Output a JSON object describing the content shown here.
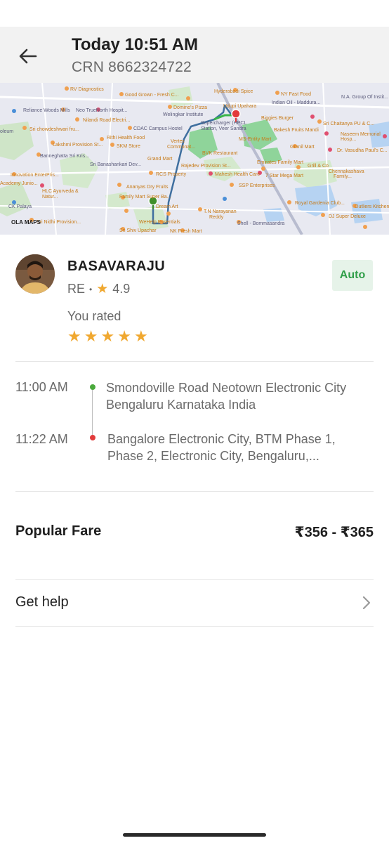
{
  "header": {
    "title": "Today 10:51 AM",
    "crn": "CRN 8662324722",
    "back_icon": "arrow-left-icon"
  },
  "map": {
    "watermark": "OLA MAPS",
    "labels": [
      "RV Diagnostics",
      "Good Grown - Fresh C...",
      "Hyderabadi Spice",
      "NY Fast Food",
      "N.A. Group Of Instit...",
      "Domino's Pizza",
      "Indian Oil - Maddura...",
      "Reliance Woods Mills",
      "Neo TrueNorth Hospit...",
      "Welingkar Institute",
      "Udupi Upahara",
      "Biggies Burger",
      "Sri Chaitanya PU & C...",
      "Nilandi Road Electri...",
      "Sri chowdeshwari fru...",
      "CDAC Campus Hostel",
      "Supercharger (HPCL",
      "Station, Veer Sandra",
      "Bakesh Fruits Mandi",
      "Naseem Memorial Hosp...",
      "oleum",
      "Lakshmi Provision St...",
      "Rithi Health Food",
      "MS-Entity Mart",
      "Granil Mart",
      "Dr. Vasudha Paul's C...",
      "SKM Store",
      "Banneghatta Sri Kris...",
      "Vertex Commonat...",
      "BVK Restaurant",
      "Emirates Family Mart",
      "Grill & Co",
      "Innovation EnterPris...",
      "Sri Banashankari Dev...",
      "Grand Mart",
      "Chennakashava Family...",
      "Academy Junio...",
      "RCS Property",
      "Rajedev Provision St...",
      "Mahesh Health Care",
      "7 Star Mega Mart",
      "HLC Ayurveda & Natur...",
      "SSP Enterprises",
      "Family Mart Super Ba...",
      "Ananyas Dry Fruits",
      "CK Palaya",
      "Royal Gardenia Club...",
      "Dream Art",
      "Outliers Kitchen",
      "Sri Nidhi Provision...",
      "T.N Narayanan Reddy",
      "WeHelp Essentials",
      "DJ Super Deluxe",
      "Shell - Bommasandra",
      "Sri Shiv Upachar",
      "NK Fresh Mart"
    ]
  },
  "driver": {
    "name": "BASAVARAJU",
    "vehicle_code": "RE",
    "rating": "4.9",
    "vehicle_type": "Auto",
    "you_rated_label": "You rated",
    "user_rating_stars": 5
  },
  "trip": {
    "pickup_time": "11:00 AM",
    "pickup_address": "Smondoville Road Neotown Electronic City Bengaluru Karnataka India",
    "drop_time": "11:22 AM",
    "drop_address": "Bangalore Electronic City, BTM Phase 1, Phase 2, Electronic City, Bengaluru,..."
  },
  "fare": {
    "label": "Popular Fare",
    "value": "₹356 - ₹365"
  },
  "help": {
    "label": "Get help"
  },
  "colors": {
    "accent_green": "#2f9e48",
    "star": "#f0a830",
    "route": "#3f6f9f",
    "pickup": "#4aa93c",
    "drop": "#e23b3b"
  }
}
